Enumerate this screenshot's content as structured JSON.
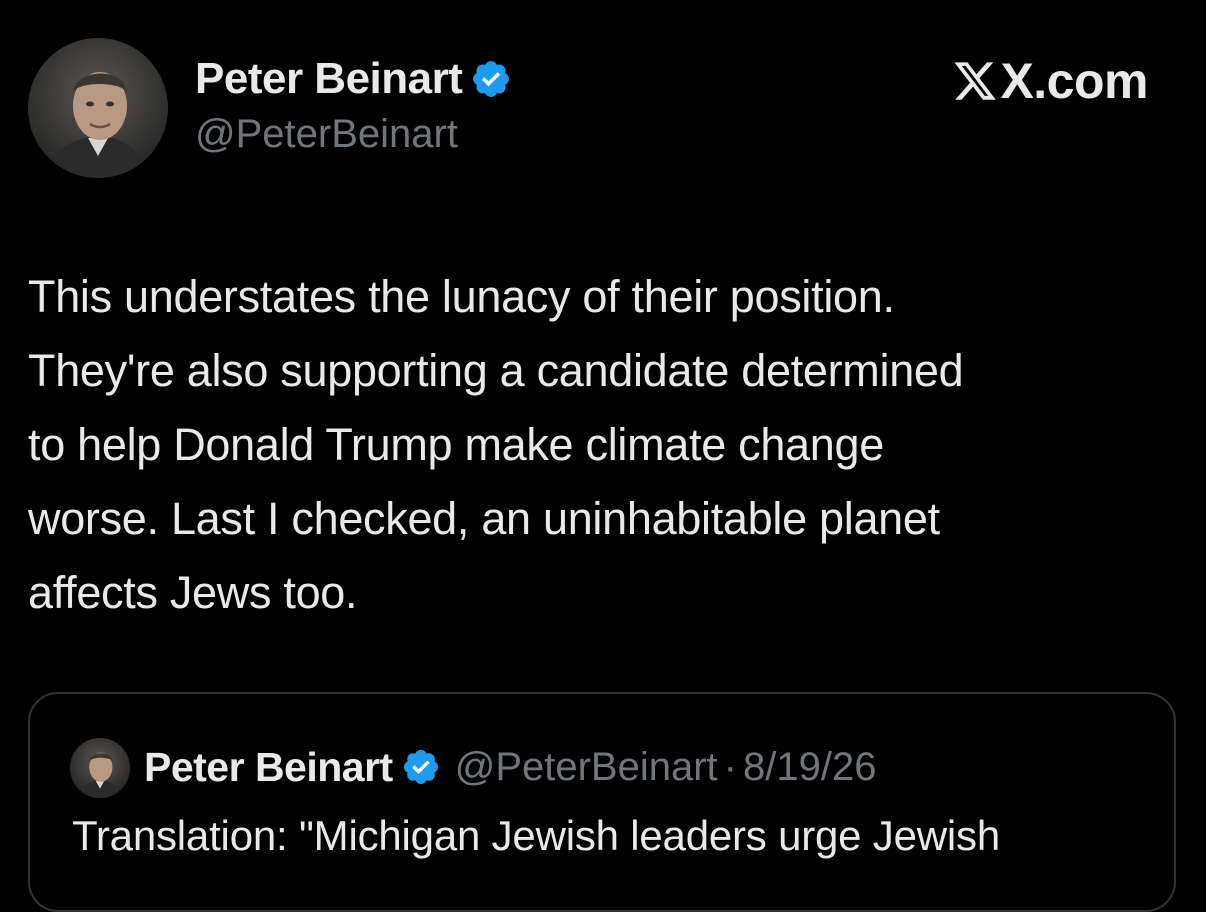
{
  "post": {
    "author": {
      "display_name": "Peter Beinart",
      "handle": "@PeterBeinart",
      "verified": true,
      "avatar_icon": "profile-photo-icon"
    },
    "site_label": "X.com",
    "site_logo_icon": "x-logo-icon",
    "text_lines": [
      "This understates the lunacy of their position.",
      "They're also supporting a candidate determined",
      "to help Donald Trump make climate change",
      "worse. Last I checked, an uninhabitable planet",
      "affects Jews too."
    ],
    "quoted_post": {
      "author": {
        "display_name": "Peter Beinart",
        "handle": "@PeterBeinart",
        "verified": true
      },
      "separator": "·",
      "date": "8/19/26",
      "text": "Translation: \"Michigan Jewish leaders urge Jewish"
    }
  },
  "colors": {
    "background": "#000000",
    "primary_text": "#e7e9ea",
    "secondary_text": "#71767b",
    "verified_badge": "#1d9bf0",
    "border": "#2f3336"
  }
}
